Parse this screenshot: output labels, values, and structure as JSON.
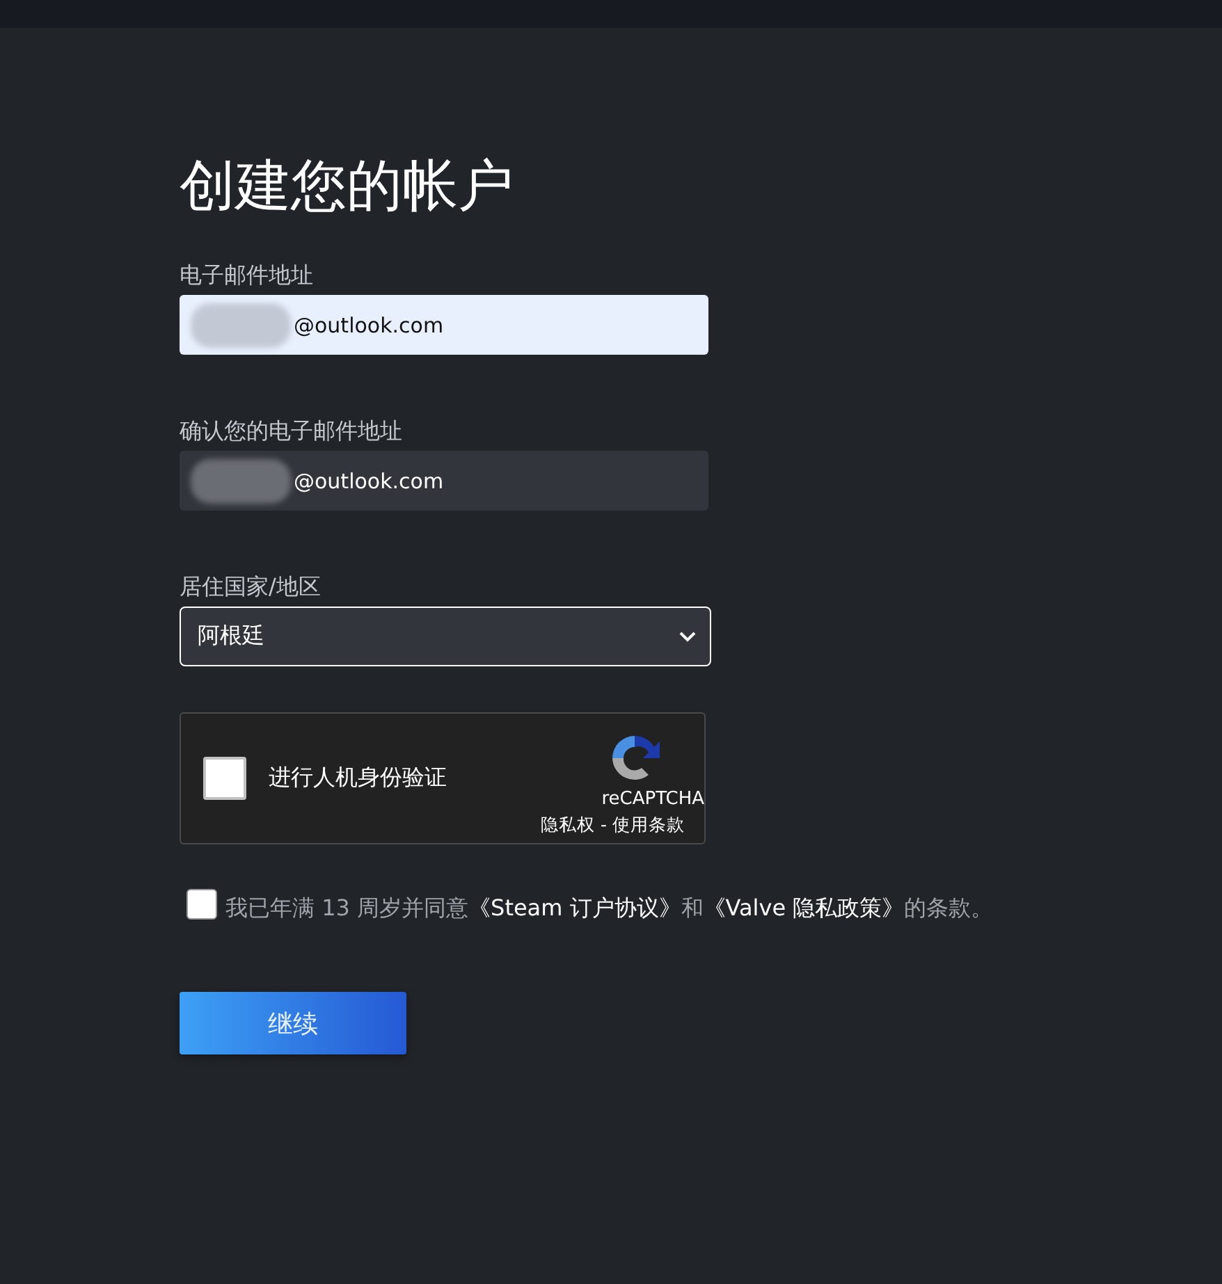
{
  "title": "创建您的帐户",
  "fields": [
    {
      "kind": "input",
      "label": "电子邮件地址",
      "value": "@outlook.com",
      "redacted": true,
      "autofilled": true
    },
    {
      "kind": "input",
      "label": "确认您的电子邮件地址",
      "value": "@outlook.com",
      "redacted": true,
      "autofilled": false
    },
    {
      "kind": "select",
      "label": "居住国家/地区",
      "value": "阿根廷",
      "focused": true
    }
  ],
  "captcha": {
    "label": "进行人机身份验证",
    "checked": false,
    "brand": "reCAPTCHA",
    "privacy": "隐私权",
    "separator": " - ",
    "terms": "使用条款"
  },
  "agreement": {
    "checked": false,
    "parts": [
      {
        "kind": "text",
        "text": "我已年满 13 周岁并同意"
      },
      {
        "kind": "link",
        "text": "《Steam 订户协议》"
      },
      {
        "kind": "text",
        "text": "和"
      },
      {
        "kind": "link",
        "text": "《Valve 隐私政策》"
      },
      {
        "kind": "text",
        "text": "的条款。"
      }
    ]
  },
  "continue_button": "继续"
}
